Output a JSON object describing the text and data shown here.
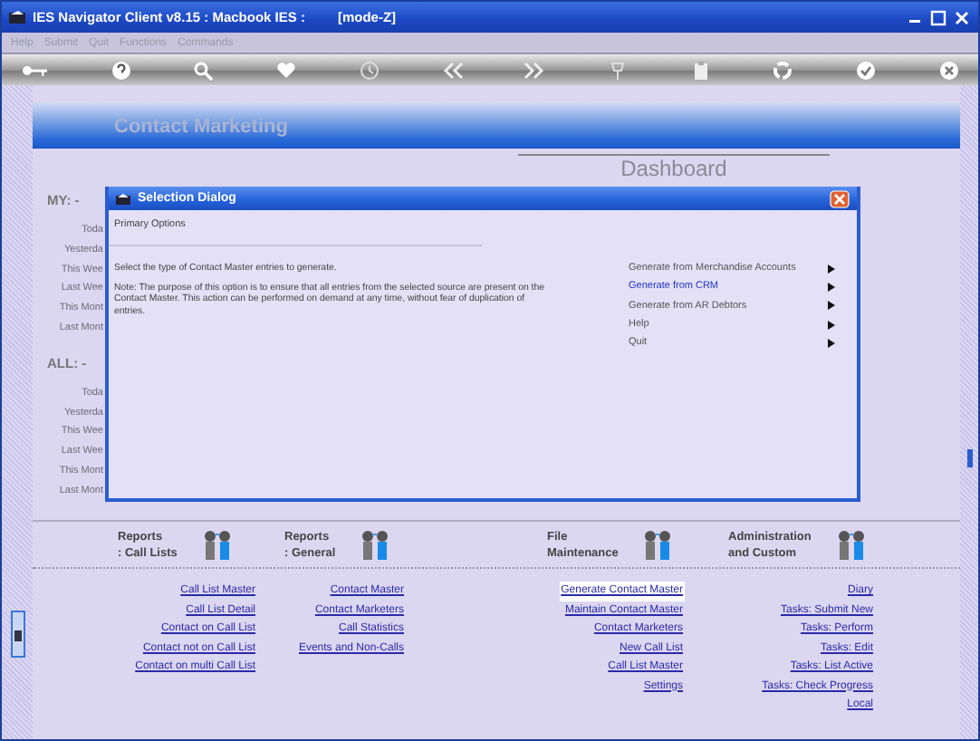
{
  "window": {
    "title": "IES Navigator Client v8.15 : Macbook IES :",
    "mode": "[mode-Z]"
  },
  "menu": [
    {
      "label": "Help",
      "disabled": true
    },
    {
      "label": "Submit",
      "disabled": true
    },
    {
      "label": "Quit",
      "disabled": true
    },
    {
      "label": "Functions",
      "disabled": true
    },
    {
      "label": "Commands",
      "disabled": true
    }
  ],
  "banner": {
    "title": "Contact Marketing"
  },
  "dashboard": {
    "title": "Dashboard"
  },
  "stats": [
    {
      "heading": "MY: -",
      "rows": [
        "Toda",
        "Yesterda",
        "This Wee",
        "Last Wee",
        "This Mont",
        "Last Mont"
      ]
    },
    {
      "heading": "ALL: -",
      "rows": [
        "Toda",
        "Yesterda",
        "This Wee",
        "Last Wee",
        "This Mont",
        "Last Mont"
      ]
    }
  ],
  "dialog": {
    "title": "Selection Dialog",
    "section": "Primary Options",
    "prompt": "Select the type of Contact Master entries to generate.",
    "note": "Note: The purpose of this option is to ensure that all entries from the selected source are present on the Contact Master. This action can be performed on demand at any time, without fear of duplication of entries.",
    "options": [
      {
        "label": "Generate from Merchandise Accounts",
        "selected": false
      },
      {
        "label": "Generate from CRM",
        "selected": true
      },
      {
        "label": "Generate from AR Debtors",
        "selected": false
      },
      {
        "label": "Help",
        "selected": false
      },
      {
        "label": "Quit",
        "selected": false
      }
    ]
  },
  "sections": [
    {
      "title": [
        "Reports",
        ": Call Lists"
      ],
      "links": [
        {
          "label": "Call List Master",
          "selected": false
        },
        {
          "label": "Call List Detail",
          "selected": false
        },
        {
          "label": "Contact on Call List",
          "selected": false
        },
        {
          "label": "Contact not on Call List",
          "selected": false
        },
        {
          "label": "Contact on multi Call List",
          "selected": false
        }
      ]
    },
    {
      "title": [
        "Reports",
        ": General"
      ],
      "links": [
        {
          "label": "Contact Master",
          "selected": false
        },
        {
          "label": "Contact Marketers",
          "selected": false
        },
        {
          "label": "Call Statistics",
          "selected": false
        },
        {
          "label": "Events and Non-Calls",
          "selected": false
        }
      ]
    },
    {
      "title": [
        "File",
        "Maintenance"
      ],
      "links": [
        {
          "label": "Generate Contact Master",
          "selected": true
        },
        {
          "label": "Maintain Contact Master",
          "selected": false
        },
        {
          "label": "Contact Marketers",
          "selected": false
        },
        {
          "label": "New Call List",
          "selected": false
        },
        {
          "label": "Call List Master",
          "selected": false
        },
        {
          "label": "Settings",
          "selected": false
        }
      ]
    },
    {
      "title": [
        "Administration",
        "and Custom"
      ],
      "links": [
        {
          "label": "Diary",
          "selected": false
        },
        {
          "label": "Tasks: Submit New",
          "selected": false
        },
        {
          "label": "Tasks: Perform",
          "selected": false
        },
        {
          "label": "Tasks: Edit",
          "selected": false
        },
        {
          "label": "Tasks: List Active",
          "selected": false
        },
        {
          "label": "Tasks: Check Progress",
          "selected": false
        },
        {
          "label": "Local",
          "selected": false
        }
      ]
    }
  ]
}
